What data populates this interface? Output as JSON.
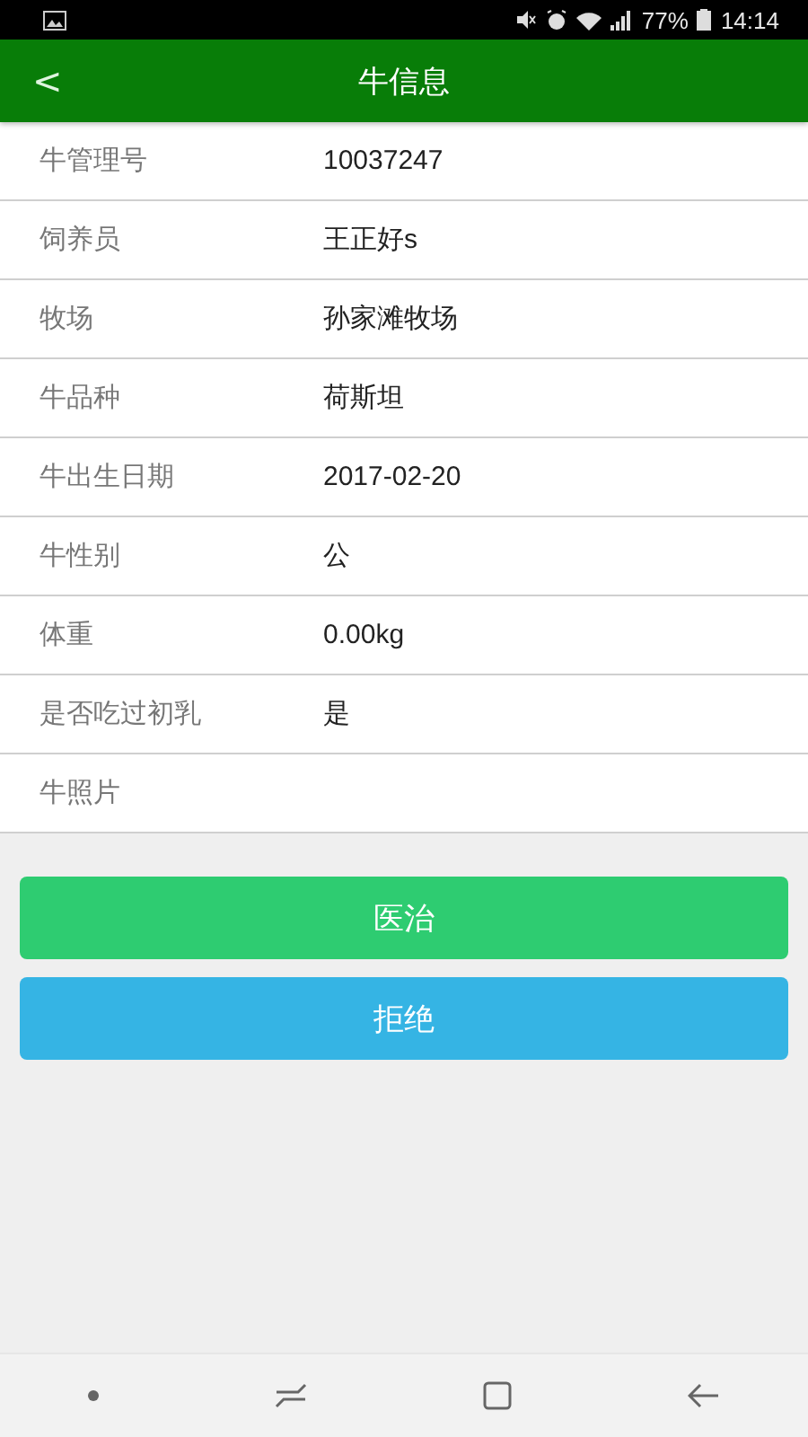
{
  "status_bar": {
    "battery": "77%",
    "time": "14:14"
  },
  "header": {
    "title": "牛信息",
    "back": "<"
  },
  "fields": [
    {
      "label": "牛管理号",
      "value": "10037247"
    },
    {
      "label": "饲养员",
      "value": "王正好s"
    },
    {
      "label": "牧场",
      "value": "孙家滩牧场"
    },
    {
      "label": "牛品种",
      "value": "荷斯坦"
    },
    {
      "label": "牛出生日期",
      "value": "2017-02-20"
    },
    {
      "label": "牛性别",
      "value": "公"
    },
    {
      "label": "体重",
      "value": "0.00kg"
    },
    {
      "label": "是否吃过初乳",
      "value": "是"
    },
    {
      "label": "牛照片"
    }
  ],
  "buttons": [
    {
      "label": "医治",
      "color": "#2ecc71"
    },
    {
      "label": "拒绝",
      "color": "#35b4e4"
    }
  ]
}
